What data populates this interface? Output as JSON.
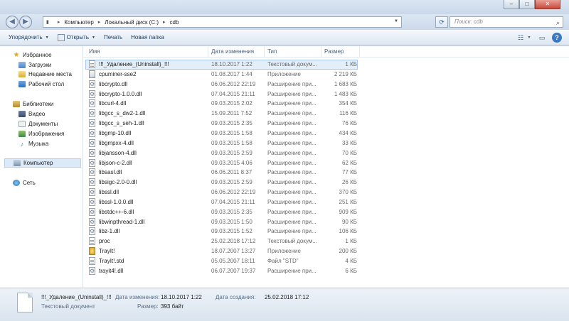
{
  "window": {
    "minimize_glyph": "–",
    "maximize_glyph": "□",
    "close_glyph": "✕"
  },
  "address": {
    "crumbs": [
      "Компьютер",
      "Локальный диск (C:)",
      "cdb"
    ],
    "search_placeholder": "Поиск: cdb"
  },
  "toolbar": {
    "organize_label": "Упорядочить",
    "open_label": "Открыть",
    "print_label": "Печать",
    "new_folder_label": "Новая папка"
  },
  "nav": {
    "favorites": "Избранное",
    "downloads": "Загрузки",
    "recent": "Недавние места",
    "desktop": "Рабочий стол",
    "libraries": "Библиотеки",
    "video": "Видео",
    "documents": "Документы",
    "images": "Изображения",
    "music": "Музыка",
    "computer": "Компьютер",
    "network": "Сеть"
  },
  "columns": {
    "name": "Имя",
    "date": "Дата изменения",
    "type": "Тип",
    "size": "Размер"
  },
  "files": [
    {
      "name": "!!!_Удаление_(Uninstall)_!!!",
      "date": "18.10.2017 1:22",
      "type": "Текстовый докум...",
      "size": "1 КБ",
      "icon": "text-file-icon"
    },
    {
      "name": "cpuminer-sse2",
      "date": "01.08.2017 1:44",
      "type": "Приложение",
      "size": "2 219 КБ",
      "icon": "exe-icon"
    },
    {
      "name": "libcrypto.dll",
      "date": "06.06.2012 22:19",
      "type": "Расширение при...",
      "size": "1 683 КБ",
      "icon": "dll-icon"
    },
    {
      "name": "libcrypto-1.0.0.dll",
      "date": "07.04.2015 21:11",
      "type": "Расширение при...",
      "size": "1 483 КБ",
      "icon": "dll-icon"
    },
    {
      "name": "libcurl-4.dll",
      "date": "09.03.2015 2:02",
      "type": "Расширение при...",
      "size": "354 КБ",
      "icon": "dll-icon"
    },
    {
      "name": "libgcc_s_dw2-1.dll",
      "date": "15.09.2011 7:52",
      "type": "Расширение при...",
      "size": "116 КБ",
      "icon": "dll-icon"
    },
    {
      "name": "libgcc_s_seh-1.dll",
      "date": "09.03.2015 2:35",
      "type": "Расширение при...",
      "size": "76 КБ",
      "icon": "dll-icon"
    },
    {
      "name": "libgmp-10.dll",
      "date": "09.03.2015 1:58",
      "type": "Расширение при...",
      "size": "434 КБ",
      "icon": "dll-icon"
    },
    {
      "name": "libgmpxx-4.dll",
      "date": "09.03.2015 1:58",
      "type": "Расширение при...",
      "size": "33 КБ",
      "icon": "dll-icon"
    },
    {
      "name": "libjansson-4.dll",
      "date": "09.03.2015 2:59",
      "type": "Расширение при...",
      "size": "70 КБ",
      "icon": "dll-icon"
    },
    {
      "name": "libjson-c-2.dll",
      "date": "09.03.2015 4:06",
      "type": "Расширение при...",
      "size": "62 КБ",
      "icon": "dll-icon"
    },
    {
      "name": "libsasl.dll",
      "date": "06.06.2011 8:37",
      "type": "Расширение при...",
      "size": "77 КБ",
      "icon": "dll-icon"
    },
    {
      "name": "libsigc-2.0-0.dll",
      "date": "09.03.2015 2:59",
      "type": "Расширение при...",
      "size": "26 КБ",
      "icon": "dll-icon"
    },
    {
      "name": "libssl.dll",
      "date": "06.06.2012 22:19",
      "type": "Расширение при...",
      "size": "370 КБ",
      "icon": "dll-icon"
    },
    {
      "name": "libssl-1.0.0.dll",
      "date": "07.04.2015 21:11",
      "type": "Расширение при...",
      "size": "251 КБ",
      "icon": "dll-icon"
    },
    {
      "name": "libstdc++-6.dll",
      "date": "09.03.2015 2:35",
      "type": "Расширение при...",
      "size": "909 КБ",
      "icon": "dll-icon"
    },
    {
      "name": "libwinpthread-1.dll",
      "date": "09.03.2015 1:50",
      "type": "Расширение при...",
      "size": "90 КБ",
      "icon": "dll-icon"
    },
    {
      "name": "libz-1.dll",
      "date": "09.03.2015 1:52",
      "type": "Расширение при...",
      "size": "106 КБ",
      "icon": "dll-icon"
    },
    {
      "name": "proc",
      "date": "25.02.2018 17:12",
      "type": "Текстовый докум...",
      "size": "1 КБ",
      "icon": "text-file-icon"
    },
    {
      "name": "TrayIt!",
      "date": "18.07.2007 13:27",
      "type": "Приложение",
      "size": "200 КБ",
      "icon": "app-icon"
    },
    {
      "name": "TrayIt!.std",
      "date": "05.05.2007 18:11",
      "type": "Файл \"STD\"",
      "size": "4 КБ",
      "icon": "text-file-icon"
    },
    {
      "name": "trayit4!.dll",
      "date": "06.07.2007 19:37",
      "type": "Расширение при...",
      "size": "6 КБ",
      "icon": "dll-icon"
    }
  ],
  "details": {
    "name": "!!!_Удаление_(Uninstall)_!!!",
    "kind": "Текстовый документ",
    "modified_label": "Дата изменения:",
    "modified_value": "18.10.2017 1:22",
    "created_label": "Дата создания:",
    "created_value": "25.02.2018 17:12",
    "size_label": "Размер:",
    "size_value": "393 байт"
  }
}
